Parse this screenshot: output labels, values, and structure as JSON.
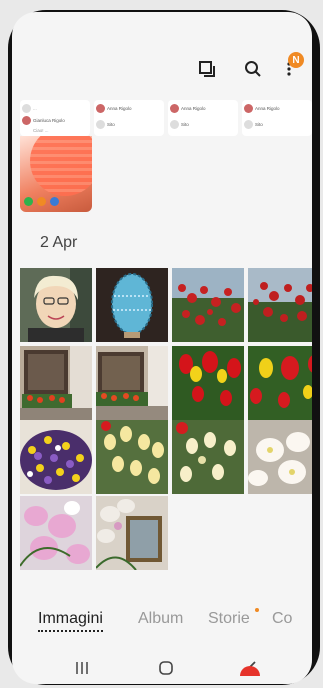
{
  "header": {
    "notification_initial": "N"
  },
  "strip": {
    "cards": [
      {
        "name": "Anna Rigolo",
        "meta": "Via ...",
        "sub": "Sito"
      },
      {
        "name": "Anna Rigolo",
        "meta": "Via ...",
        "sub": "Sito"
      },
      {
        "name": "Anna Rigolo",
        "meta": "Via ...",
        "sub": "Sito"
      }
    ],
    "first_card": {
      "line1": "Gianluca Rigolo",
      "line2": "Ciao! ..."
    }
  },
  "section": {
    "date": "2 Apr"
  },
  "tabs": [
    {
      "label": "Immagini",
      "active": true
    },
    {
      "label": "Album",
      "active": false
    },
    {
      "label": "Storie",
      "active": false,
      "dot": true
    },
    {
      "label": "Co",
      "active": false
    }
  ],
  "colors": {
    "accent": "#f08a24",
    "active_text": "#222222",
    "inactive_text": "#999999"
  },
  "icons": [
    "slideshow-icon",
    "search-icon",
    "more-icon",
    "recent-apps-icon",
    "home-icon",
    "back-icon"
  ]
}
